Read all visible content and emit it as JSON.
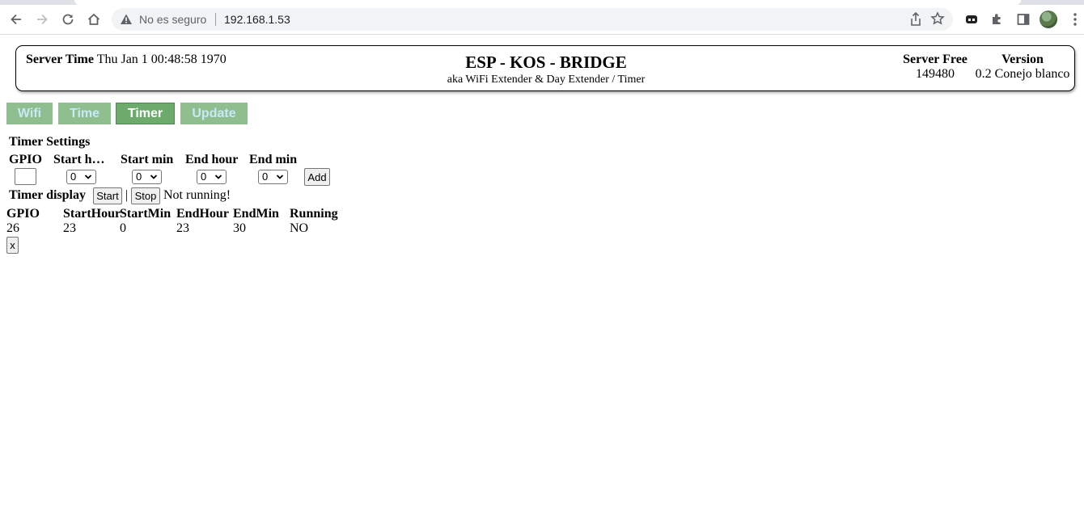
{
  "browser": {
    "security_text": "No es seguro",
    "url": "192.168.1.53"
  },
  "header": {
    "server_time_label": "Server Time",
    "server_time_value": "Thu Jan 1 00:48:58 1970",
    "title": "ESP - KOS - BRIDGE",
    "subtitle": "aka WiFi Extender & Day Extender / Timer",
    "server_free_label": "Server Free",
    "server_free_value": "149480",
    "version_label": "Version",
    "version_value": "0.2 Conejo blanco"
  },
  "tabs": [
    {
      "label": "Wifi",
      "active": false
    },
    {
      "label": "Time",
      "active": false
    },
    {
      "label": "Timer",
      "active": true
    },
    {
      "label": "Update",
      "active": false
    }
  ],
  "timer_settings": {
    "title": "Timer Settings",
    "columns": [
      "GPIO",
      "Start h…",
      "Start min",
      "End hour",
      "End min"
    ],
    "gpio_value": "",
    "start_hour": "0",
    "start_min": "0",
    "end_hour": "0",
    "end_min": "0",
    "add_label": "Add"
  },
  "timer_display": {
    "label": "Timer display",
    "start_label": "Start",
    "separator": "|",
    "stop_label": "Stop",
    "status": "Not running!"
  },
  "table": {
    "headers": [
      "GPIO",
      "StartHour",
      "StartMin",
      "EndHour",
      "EndMin",
      "Running"
    ],
    "rows": [
      [
        "26",
        "23",
        "0",
        "23",
        "30",
        "NO"
      ]
    ],
    "delete_label": "x"
  }
}
